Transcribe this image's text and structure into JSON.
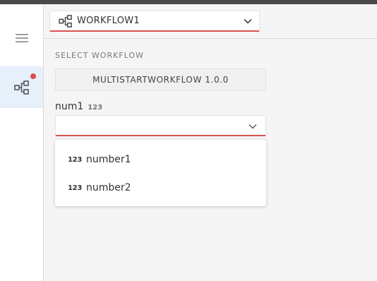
{
  "sidebar": {
    "items": [
      {
        "icon": "hamburger-menu-icon"
      },
      {
        "icon": "workflow-icon",
        "badge_color": "#e04c4c",
        "active": true
      }
    ]
  },
  "header": {
    "workflow_select": {
      "label": "WORKFLOW1",
      "icon": "workflow-icon"
    }
  },
  "main": {
    "section_label": "SELECT WORKFLOW",
    "workflow_version": "MULTISTARTWORKFLOW 1.0.0",
    "field": {
      "name": "num1",
      "type_badge": "123",
      "value": ""
    },
    "dropdown": {
      "options": [
        {
          "type": "123",
          "label": "number1"
        },
        {
          "type": "123",
          "label": "number2"
        }
      ]
    }
  },
  "colors": {
    "accent": "#d9534f",
    "active_bg": "#e6f0fb"
  }
}
